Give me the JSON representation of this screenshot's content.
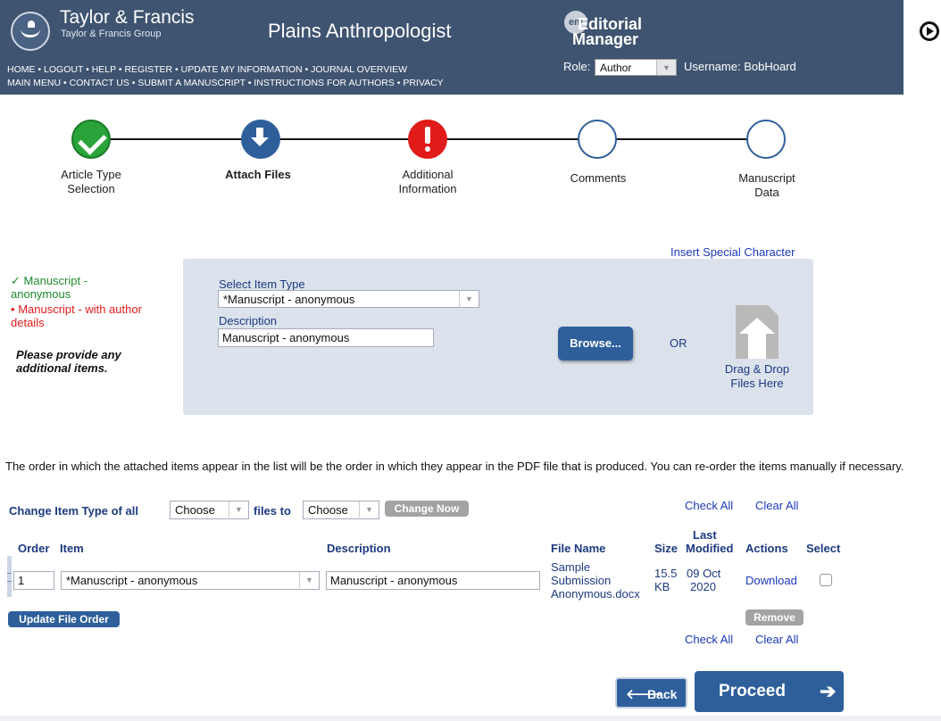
{
  "header": {
    "brand": "Taylor & Francis",
    "brand_sub": "Taylor & Francis Group",
    "journal": "Plains Anthropologist",
    "em_badge": "em",
    "em_line1": "Editorial",
    "em_line2": "Manager",
    "role_label": "Role:",
    "role_value": "Author",
    "username": "Username: BobHoard",
    "nav_row1": [
      "HOME",
      "LOGOUT",
      "HELP",
      "REGISTER",
      "UPDATE MY INFORMATION",
      "JOURNAL OVERVIEW"
    ],
    "nav_row2": [
      "MAIN MENU",
      "CONTACT US",
      "SUBMIT A MANUSCRIPT",
      "INSTRUCTIONS FOR AUTHORS",
      "PRIVACY"
    ]
  },
  "steps": [
    {
      "label1": "Article Type",
      "label2": "Selection",
      "state": "done"
    },
    {
      "label1": "Attach Files",
      "label2": "",
      "state": "active"
    },
    {
      "label1": "Additional",
      "label2": "Information",
      "state": "error"
    },
    {
      "label1": "Comments",
      "label2": "",
      "state": "empty"
    },
    {
      "label1": "Manuscript",
      "label2": "Data",
      "state": "empty"
    }
  ],
  "upload": {
    "special_char": "Insert Special Character",
    "check_mark": "✓",
    "ok_item_line1": "Manuscript -",
    "ok_item_line2": "anonymous",
    "bullet": "•",
    "err_item_line1": "Manuscript - with author",
    "err_item_line2": "details",
    "note_line1": "Please provide any",
    "note_line2": "additional items.",
    "select_label": "Select Item Type",
    "select_value": "*Manuscript - anonymous",
    "desc_label": "Description",
    "desc_value": "Manuscript - anonymous",
    "browse": "Browse...",
    "or": "OR",
    "drop_line1": "Drag & Drop",
    "drop_line2": "Files Here"
  },
  "order_note": "The order in which the attached items appear in the list will be the order in which they appear in the PDF file that is produced. You can re-order the items manually if necessary.",
  "change_row": {
    "label1": "Change Item Type of all",
    "choose1": "Choose",
    "label2": "files to",
    "choose2": "Choose",
    "change_now": "Change Now",
    "check_all": "Check All",
    "clear_all": "Clear All"
  },
  "table": {
    "headers": {
      "order": "Order",
      "item": "Item",
      "description": "Description",
      "file_name": "File Name",
      "size": "Size",
      "last": "Last",
      "modified": "Modified",
      "actions": "Actions",
      "select": "Select"
    },
    "rows": [
      {
        "order": "1",
        "item": "*Manuscript - anonymous",
        "description": "Manuscript - anonymous",
        "file_line1": "Sample",
        "file_line2": "Submission",
        "file_line3": "Anonymous.docx",
        "size_line1": "15.5",
        "size_line2": "KB",
        "date_line1": "09 Oct",
        "date_line2": "2020",
        "action": "Download"
      }
    ],
    "remove": "Remove",
    "update_order": "Update File Order",
    "check_all": "Check All",
    "clear_all": "Clear All"
  },
  "footer": {
    "back_icon": "🡐",
    "back": "Back",
    "proceed": "Proceed",
    "proceed_icon": "➔"
  },
  "colors": {
    "header_bg": "#3f5470",
    "primary_button": "#2e5f9b",
    "ok_green": "#2aa33a",
    "error_red": "#e11a1a",
    "link_blue": "#1c38b8"
  }
}
